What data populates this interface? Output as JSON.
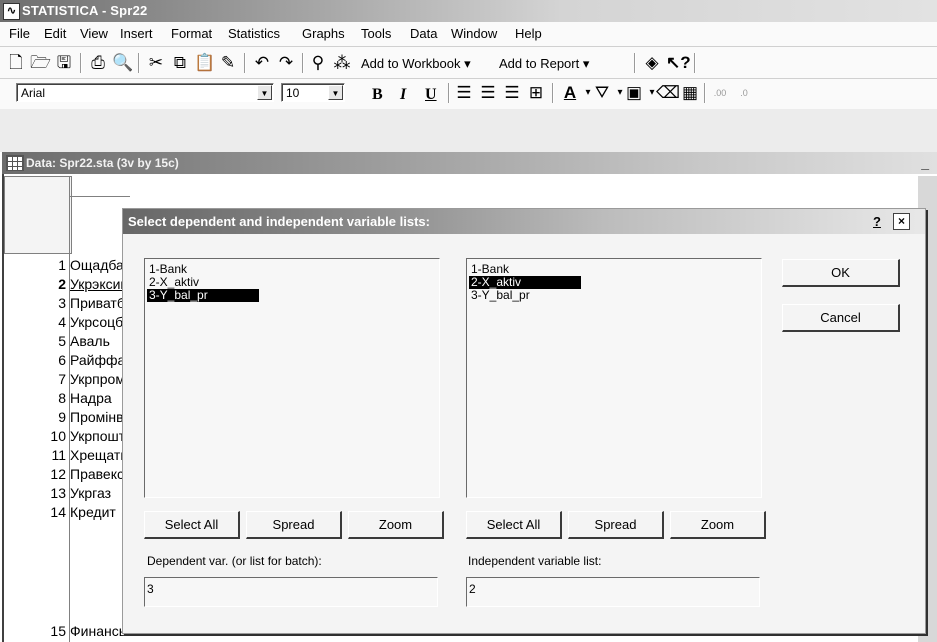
{
  "app": {
    "title": "STATISTICA - Spr22",
    "icon_glyph": "⁄‿"
  },
  "menu": [
    {
      "label": "File"
    },
    {
      "label": "Edit"
    },
    {
      "label": "View"
    },
    {
      "label": "Insert"
    },
    {
      "label": "Format"
    },
    {
      "label": "Statistics"
    },
    {
      "label": "Graphs"
    },
    {
      "label": "Tools"
    },
    {
      "label": "Data"
    },
    {
      "label": "Window"
    },
    {
      "label": "Help"
    }
  ],
  "toolbar": {
    "add_to_workbook": "Add to Workbook ▾",
    "add_to_report": "Add to Report ▾",
    "font_name": "Arial",
    "font_size": "10",
    "bold": "B",
    "italic": "I",
    "underline": "U"
  },
  "data_window": {
    "title": "Data: Spr22.sta (3v by 15c)",
    "minimize": "_"
  },
  "grid": {
    "rows": [
      {
        "num": "1",
        "cell": "Ощадбанк"
      },
      {
        "num": "2",
        "cell": "Укрэксимбанк"
      },
      {
        "num": "3",
        "cell": "Приватбанк"
      },
      {
        "num": "4",
        "cell": "Укрсоцбанк"
      },
      {
        "num": "5",
        "cell": "Аваль"
      },
      {
        "num": "6",
        "cell": "Райффайзен"
      },
      {
        "num": "7",
        "cell": "Укрпромбанк"
      },
      {
        "num": "8",
        "cell": "Надра"
      },
      {
        "num": "9",
        "cell": "Промінвест"
      },
      {
        "num": "10",
        "cell": "Укрпошта"
      },
      {
        "num": "11",
        "cell": "Хрещатик"
      },
      {
        "num": "12",
        "cell": "Правекс"
      },
      {
        "num": "13",
        "cell": "Укргаз"
      },
      {
        "num": "14",
        "cell": "Кредит"
      },
      {
        "num": "15",
        "cell": "Финансы и"
      }
    ]
  },
  "dialog": {
    "title": "Select dependent and independent variable lists:",
    "help": "?",
    "close": "×",
    "left_list": [
      "1-Bank",
      "2-X_aktiv",
      "3-Y_bal_pr"
    ],
    "left_selected_index": 2,
    "right_list": [
      "1-Bank",
      "2-X_aktiv",
      "3-Y_bal_pr"
    ],
    "right_selected_index": 1,
    "buttons": {
      "ok": "OK",
      "cancel": "Cancel",
      "select_all_left": "Select All",
      "spread_left": "Spread",
      "zoom_left": "Zoom",
      "select_all_right": "Select All",
      "spread_right": "Spread",
      "zoom_right": "Zoom"
    },
    "dependent_label": "Dependent var. (or list for batch):",
    "dependent_value": "3",
    "independent_label": "Independent variable list:",
    "independent_value": "2"
  }
}
